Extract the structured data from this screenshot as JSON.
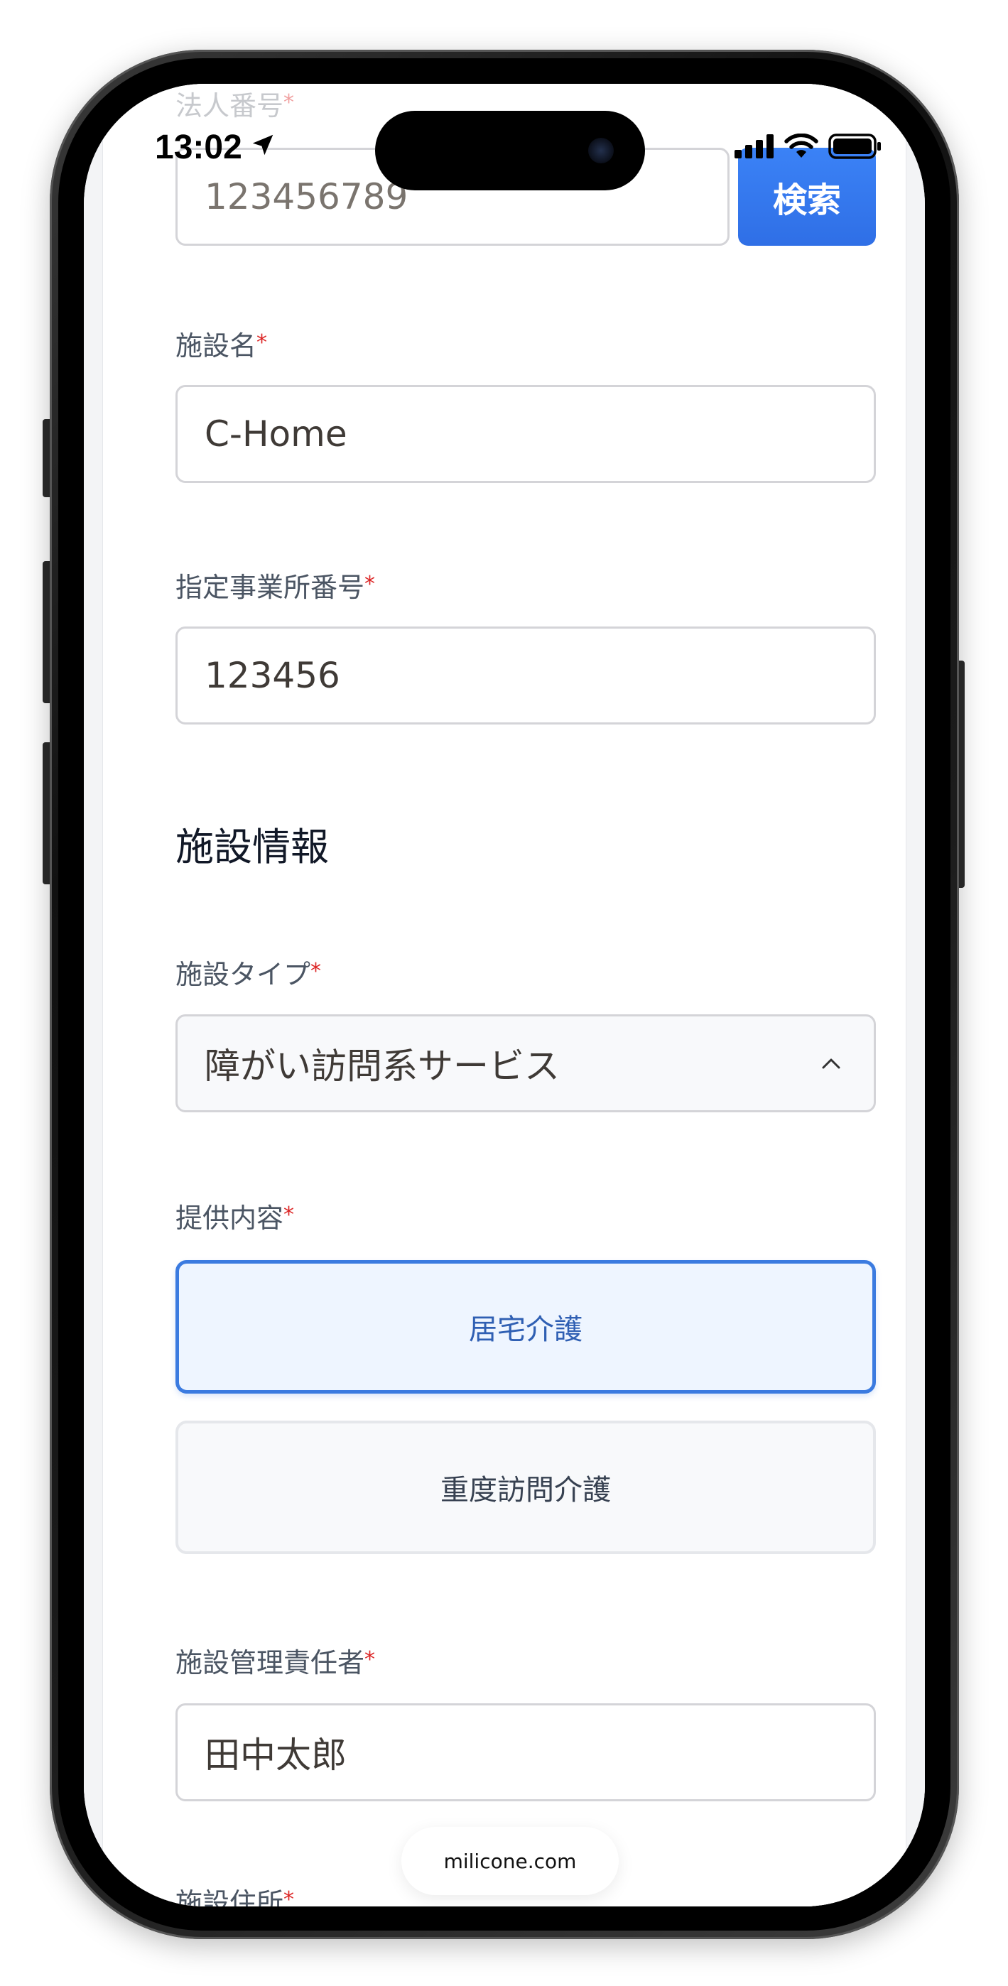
{
  "status_bar": {
    "time": "13:02"
  },
  "form": {
    "corporate_number": {
      "label": "法人番号",
      "required_mark": "*",
      "value": "123456789",
      "search_button": "検索"
    },
    "facility_name": {
      "label": "施設名",
      "required_mark": "*",
      "value": "C-Home"
    },
    "office_number": {
      "label": "指定事業所番号",
      "required_mark": "*",
      "value": "123456"
    },
    "section_title": "施設情報",
    "facility_type": {
      "label": "施設タイプ",
      "required_mark": "*",
      "selected": "障がい訪問系サービス"
    },
    "services": {
      "label": "提供内容",
      "required_mark": "*",
      "options": [
        {
          "label": "居宅介護",
          "selected": true
        },
        {
          "label": "重度訪問介護",
          "selected": false
        }
      ]
    },
    "manager": {
      "label": "施設管理責任者",
      "required_mark": "*",
      "value": "田中太郎"
    },
    "address": {
      "label": "施設住所",
      "required_mark": "*"
    }
  },
  "browser": {
    "url": "milicone.com"
  },
  "colors": {
    "primary": "#3b82f6",
    "selected_border": "#3b7be0",
    "required": "#dc2626"
  }
}
